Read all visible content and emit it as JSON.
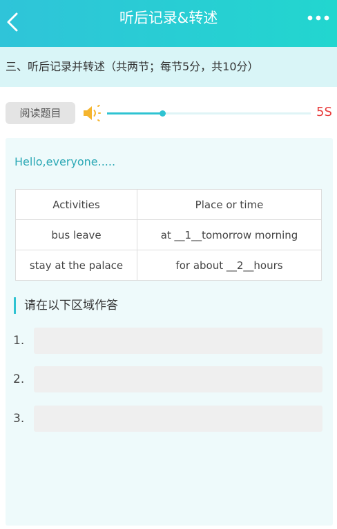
{
  "header": {
    "title": "听后记录&转述",
    "back_icon": "chevron-left-icon",
    "more_icon": "more-dots-icon"
  },
  "section": {
    "title": "三、听后记录并转述（共两节；每节5分，共10分）"
  },
  "audio": {
    "read_button": "阅读题目",
    "speaker_icon": "speaker-icon",
    "progress": 0.27,
    "timer": "5S",
    "accent_color": "#2ec3d2",
    "timer_color": "#e83b3b"
  },
  "content": {
    "intro": "Hello,everyone.....",
    "table": {
      "headers": [
        "Activities",
        "Place or time"
      ],
      "rows": [
        [
          "bus leave",
          "at __1__tomorrow morning"
        ],
        [
          "stay at the palace",
          "for about __2__hours"
        ]
      ]
    },
    "answer_area_title": "请在以下区域作答",
    "answers": [
      {
        "number": "1.",
        "value": ""
      },
      {
        "number": "2.",
        "value": ""
      },
      {
        "number": "3.",
        "value": ""
      }
    ]
  }
}
